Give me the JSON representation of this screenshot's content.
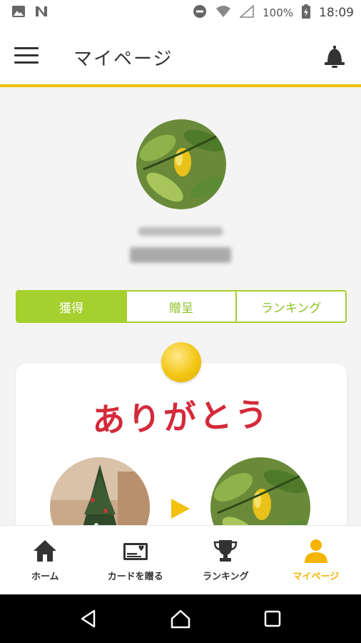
{
  "status_bar": {
    "battery": "100%",
    "time": "18:09"
  },
  "app_bar": {
    "title": "マイページ"
  },
  "tabs": [
    {
      "label": "獲得",
      "active": true
    },
    {
      "label": "贈呈",
      "active": false
    },
    {
      "label": "ランキング",
      "active": false
    }
  ],
  "card": {
    "message": "ありがとう"
  },
  "bottom_nav": [
    {
      "label": "ホーム",
      "icon": "home-icon",
      "active": false
    },
    {
      "label": "カードを贈る",
      "icon": "card-send-icon",
      "active": false
    },
    {
      "label": "ランキング",
      "icon": "trophy-icon",
      "active": false
    },
    {
      "label": "マイページ",
      "icon": "person-icon",
      "active": true
    }
  ],
  "colors": {
    "accent_green": "#a5d02e",
    "accent_yellow": "#f4c20d",
    "thanks_red": "#d42a3a"
  }
}
